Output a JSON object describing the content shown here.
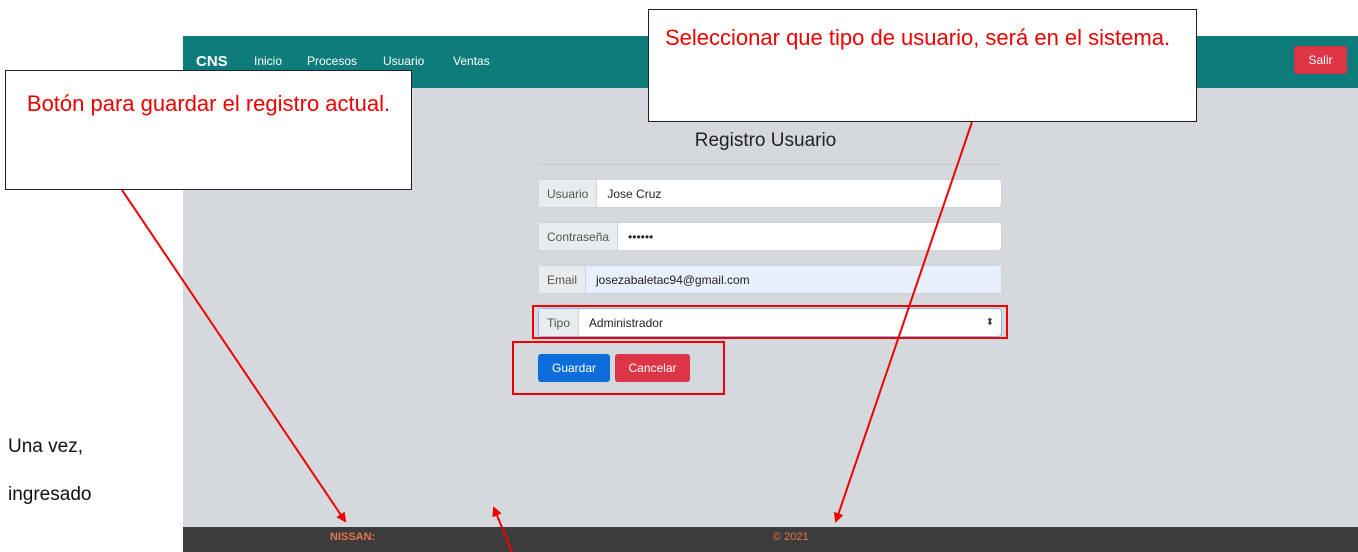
{
  "navbar": {
    "brand": "CNS",
    "links": [
      "Inicio",
      "Procesos",
      "Usuario",
      "Ventas"
    ],
    "logout": "Salir"
  },
  "form": {
    "title": "Registro Usuario",
    "usuario": {
      "label": "Usuario",
      "value": "Jose Cruz"
    },
    "contrasena": {
      "label": "Contraseña",
      "value": "••••••"
    },
    "email": {
      "label": "Email",
      "value": "josezabaletac94@gmail.com"
    },
    "tipo": {
      "label": "Tipo",
      "selected": "Administrador"
    },
    "save": "Guardar",
    "cancel": "Cancelar"
  },
  "footer": {
    "brand": "NISSAN:",
    "copyright": "© 2021"
  },
  "annotations": {
    "save_callout": "Botón para guardar el registro actual.",
    "type_callout": "Seleccionar que tipo de usuario, será en el sistema.",
    "highlight_color": "#ee0000"
  },
  "side_text": [
    "Una   vez,",
    "ingresado"
  ]
}
